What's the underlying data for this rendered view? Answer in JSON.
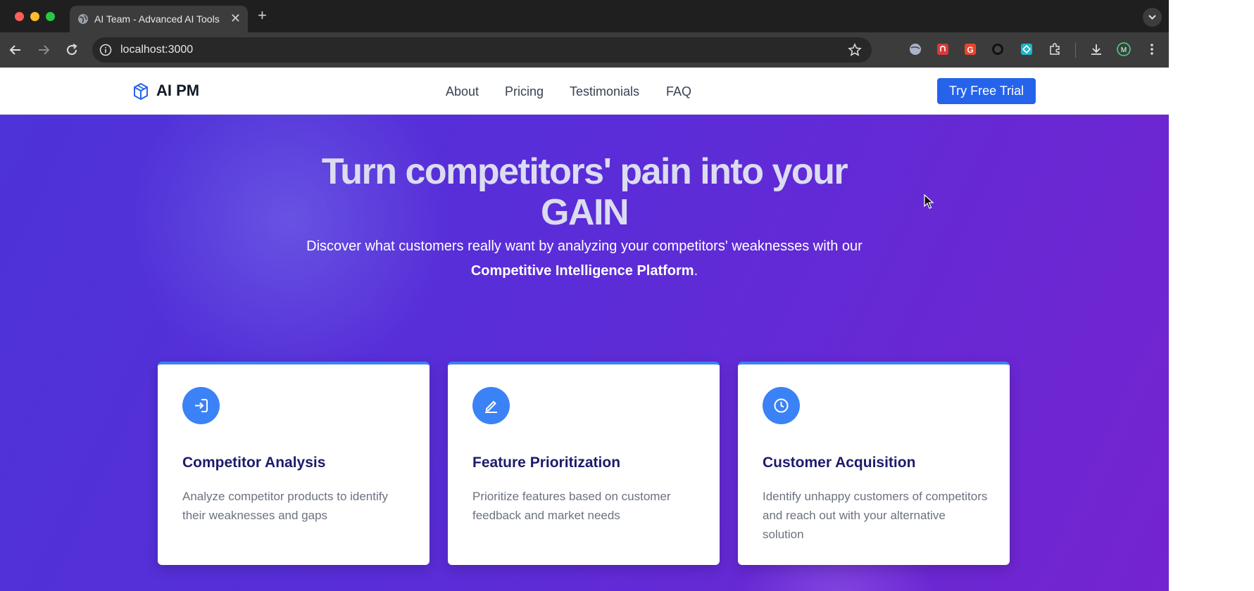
{
  "browser": {
    "tab": {
      "title": "AI Team - Advanced AI Tools",
      "close": "✕"
    },
    "new_tab": "+",
    "address": {
      "url": "localhost:3000"
    }
  },
  "site": {
    "logo": "AI PM",
    "nav": [
      {
        "label": "About"
      },
      {
        "label": "Pricing"
      },
      {
        "label": "Testimonials"
      },
      {
        "label": "FAQ"
      }
    ],
    "cta": "Try Free Trial"
  },
  "hero": {
    "title": "Turn competitors' pain into your GAIN",
    "subtitle_line1": "Discover what customers really want by analyzing your competitors' weaknesses with our",
    "subtitle_bold": "Competitive Intelligence Platform",
    "subtitle_end": "."
  },
  "features": [
    {
      "icon": "login-arrow-icon",
      "title": "Competitor Analysis",
      "description": "Analyze competitor products to identify their weaknesses and gaps"
    },
    {
      "icon": "pencil-icon",
      "title": "Feature Prioritization",
      "description": "Prioritize features based on customer feedback and market needs"
    },
    {
      "icon": "clock-icon",
      "title": "Customer Acquisition",
      "description": "Identify unhappy customers of competitors and reach out with your alternative solution"
    }
  ],
  "colors": {
    "brand_blue": "#2563eb",
    "accent_blue": "#3b82f6",
    "hero_gradient_start": "#4d33d8",
    "hero_gradient_end": "#7424d0",
    "card_title": "#1e1b6b"
  }
}
